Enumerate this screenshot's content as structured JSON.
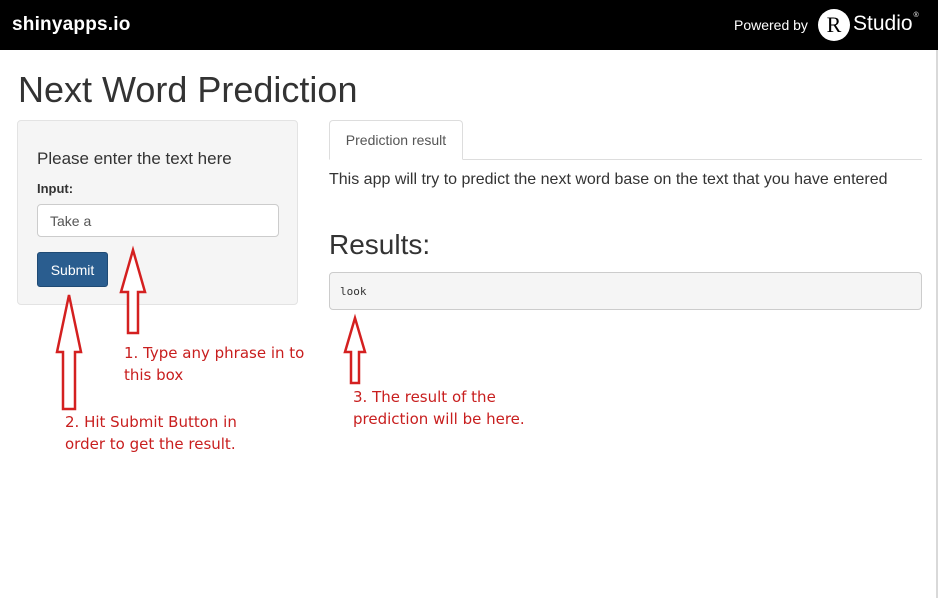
{
  "topbar": {
    "brand": "shinyapps.io",
    "powered_by": "Powered by",
    "logo_letter": "R",
    "logo_text": "Studio",
    "logo_mark": "®"
  },
  "page": {
    "title": "Next Word Prediction"
  },
  "sidebar": {
    "heading": "Please enter the text here",
    "input_label": "Input:",
    "input_value": "Take a",
    "submit_label": "Submit"
  },
  "main": {
    "tabs": [
      {
        "label": "Prediction result",
        "active": true
      }
    ],
    "description": "This app will try to predict the next word base on the text that you have entered",
    "results_heading": "Results:",
    "result_value": "look"
  },
  "annotations": {
    "note_1": "1. Type any phrase in to this box",
    "note_2": "2. Hit Submit Button in order to get the result.",
    "note_3": "3. The result of the prediction will be here.",
    "color": "#c81e1e"
  },
  "colors": {
    "topbar": "#000000",
    "button": "#2a5d8f",
    "panel": "#f5f5f5"
  }
}
